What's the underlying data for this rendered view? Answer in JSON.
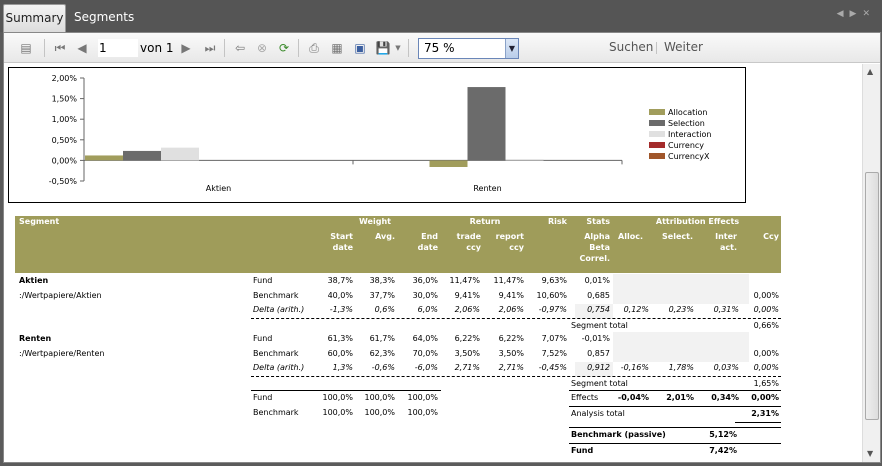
{
  "tabs": [
    {
      "label": "Summary"
    },
    {
      "label": "Segments"
    }
  ],
  "toolbar": {
    "page": "1",
    "of_label": "von",
    "of_value": "1",
    "zoom": "75 %",
    "search": "Suchen",
    "next": "Weiter"
  },
  "chart_data": {
    "type": "bar",
    "categories": [
      "Aktien",
      "Renten"
    ],
    "series": [
      {
        "name": "Allocation",
        "color": "#a19d5c",
        "values": [
          0.12,
          -0.16
        ]
      },
      {
        "name": "Selection",
        "color": "#6b6b6b",
        "values": [
          0.23,
          1.78
        ]
      },
      {
        "name": "Interaction",
        "color": "#e0e0e0",
        "values": [
          0.31,
          0.03
        ]
      },
      {
        "name": "Currency",
        "color": "#a42b2b",
        "values": [
          0,
          0
        ]
      },
      {
        "name": "CurrencyX",
        "color": "#a0562a",
        "values": [
          0,
          0
        ]
      }
    ],
    "ylim": [
      -0.5,
      2.0
    ],
    "yticks": [
      "2,00%",
      "1,50%",
      "1,00%",
      "0,50%",
      "0,00%",
      "-0,50%"
    ],
    "legend": "right"
  },
  "table": {
    "headers": {
      "segment": "Segment",
      "weight": "Weight",
      "start": "Start date",
      "avg": "Avg.",
      "end": "End date",
      "return": "Return",
      "trade": "trade ccy",
      "report": "report ccy",
      "risk": "Risk",
      "stats": "Stats",
      "alpha": "Alpha Beta Correl.",
      "attrib": "Attribution Effects",
      "alloc": "Alloc.",
      "select": "Select.",
      "inter": "Inter act.",
      "ccy": "Ccy"
    },
    "groups": [
      {
        "name": "Aktien",
        "path": ":/Wertpapiere/Aktien",
        "rows": [
          {
            "label": "Fund",
            "vals": [
              "38,7%",
              "38,3%",
              "36,0%",
              "11,47%",
              "11,47%",
              "9,63%",
              "0,01%",
              "",
              "",
              "",
              ""
            ]
          },
          {
            "label": "Benchmark",
            "vals": [
              "40,0%",
              "37,7%",
              "30,0%",
              "9,41%",
              "9,41%",
              "10,60%",
              "0,685",
              "",
              "",
              "",
              "0,00%"
            ]
          },
          {
            "label": "Delta (arith.)",
            "vals": [
              "-1,3%",
              "0,6%",
              "6,0%",
              "2,06%",
              "2,06%",
              "-0,97%",
              "0,754",
              "0,12%",
              "0,23%",
              "0,31%",
              "0,00%"
            ]
          }
        ],
        "total_label": "Segment total",
        "total": "0,66%"
      },
      {
        "name": "Renten",
        "path": ":/Wertpapiere/Renten",
        "rows": [
          {
            "label": "Fund",
            "vals": [
              "61,3%",
              "61,7%",
              "64,0%",
              "6,22%",
              "6,22%",
              "7,07%",
              "-0,01%",
              "",
              "",
              "",
              ""
            ]
          },
          {
            "label": "Benchmark",
            "vals": [
              "60,0%",
              "62,3%",
              "70,0%",
              "3,50%",
              "3,50%",
              "7,52%",
              "0,857",
              "",
              "",
              "",
              "0,00%"
            ]
          },
          {
            "label": "Delta (arith.)",
            "vals": [
              "1,3%",
              "-0,6%",
              "-6,0%",
              "2,71%",
              "2,71%",
              "-0,45%",
              "0,912",
              "-0,16%",
              "1,78%",
              "0,03%",
              "0,00%"
            ]
          }
        ],
        "total_label": "Segment total",
        "total": "1,65%"
      }
    ],
    "totals": [
      {
        "label": "Fund",
        "vals": [
          "100,0%",
          "100,0%",
          "100,0%"
        ]
      },
      {
        "label": "Benchmark",
        "vals": [
          "100,0%",
          "100,0%",
          "100,0%"
        ]
      }
    ],
    "effects": {
      "label": "Effects",
      "vals": [
        "-0,04%",
        "2,01%",
        "0,34%",
        "0,00%"
      ]
    },
    "analysis": {
      "label": "Analysis total",
      "val": "2,31%"
    },
    "bench_passive": {
      "label": "Benchmark (passive)",
      "val": "5,12%"
    },
    "fund": {
      "label": "Fund",
      "val": "7,42%"
    }
  }
}
